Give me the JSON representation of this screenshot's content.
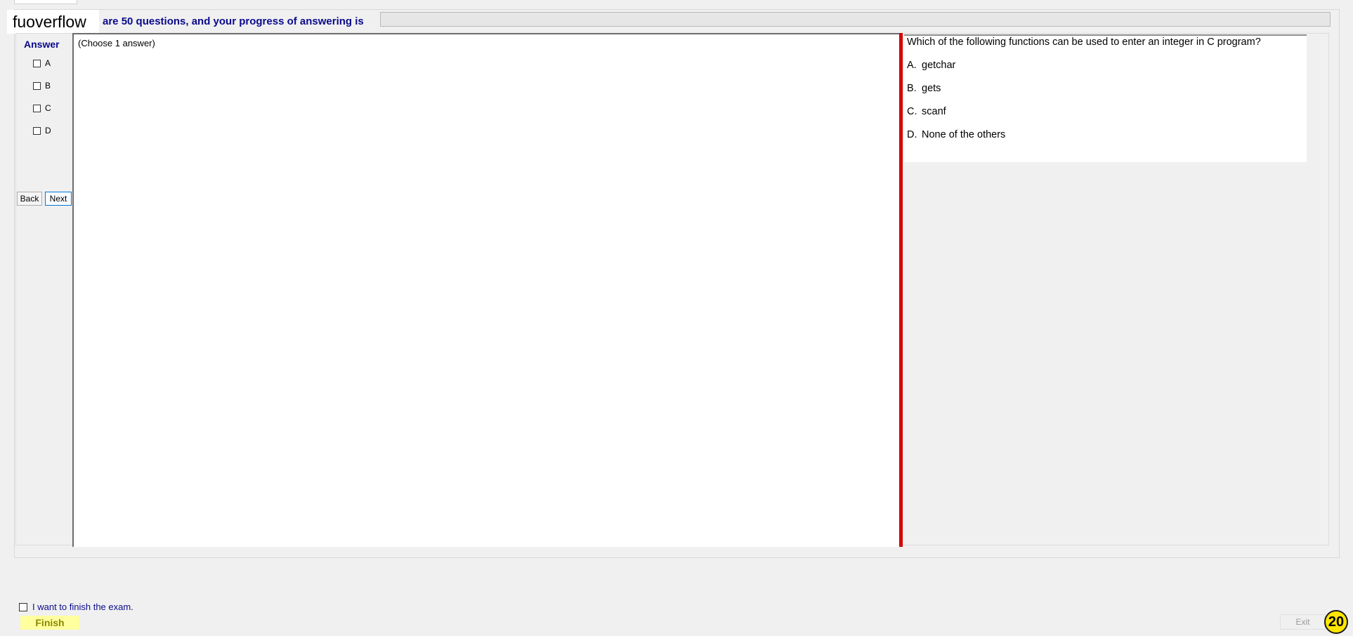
{
  "header": {
    "brand": "fuoverflow",
    "progress_text": "are 50 questions, and your progress of answering is",
    "progress_fraction": 0
  },
  "answer_panel": {
    "title": "Answer",
    "options": [
      "A",
      "B",
      "C",
      "D"
    ],
    "back_label": "Back",
    "next_label": "Next"
  },
  "main": {
    "instruction": "(Choose 1 answer)"
  },
  "question": {
    "text": "Which of the following functions can be used to enter an integer in C program?",
    "options": [
      {
        "letter": "A.",
        "text": "getchar"
      },
      {
        "letter": "B.",
        "text": "gets"
      },
      {
        "letter": "C.",
        "text": "scanf"
      },
      {
        "letter": "D.",
        "text": "None of the others"
      }
    ]
  },
  "footer": {
    "finish_check_label": "I want to finish the exam.",
    "finish_label": "Finish",
    "exit_label": "Exit",
    "question_number": "20"
  },
  "colors": {
    "accent_blue": "#0a0a8c",
    "splitter_red": "#d40000",
    "finish_yellow": "#ffffa0",
    "counter_yellow": "#ffe600"
  }
}
